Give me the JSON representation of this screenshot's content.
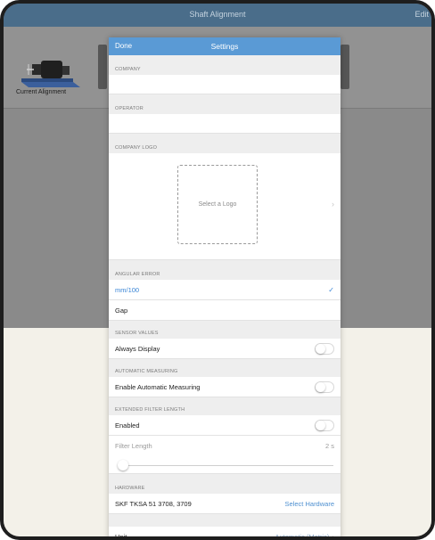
{
  "background": {
    "title": "Shaft Alignment",
    "edit_label": "Edit",
    "thumb_label": "Current Alignment"
  },
  "modal": {
    "done_label": "Done",
    "title": "Settings",
    "company": {
      "header": "COMPANY",
      "value": ""
    },
    "operator": {
      "header": "OPERATOR",
      "value": ""
    },
    "company_logo": {
      "header": "COMPANY LOGO",
      "placeholder": "Select a Logo"
    },
    "angular_error": {
      "header": "ANGULAR ERROR",
      "options": [
        {
          "label": "mm/100",
          "selected": true
        },
        {
          "label": "Gap",
          "selected": false
        }
      ]
    },
    "sensor_values": {
      "header": "SENSOR VALUES",
      "label": "Always Display",
      "on": false
    },
    "automatic_measuring": {
      "header": "AUTOMATIC MEASURING",
      "label": "Enable Automatic Measuring",
      "on": false
    },
    "extended_filter": {
      "header": "EXTENDED FILTER LENGTH",
      "enabled_label": "Enabled",
      "enabled": false,
      "filter_label": "Filter Length",
      "filter_value": "2 s"
    },
    "hardware": {
      "header": "HARDWARE",
      "value": "SKF TKSA 51 3708, 3709",
      "action": "Select Hardware"
    },
    "unit": {
      "label": "Unit",
      "value": "Automatic (Metric)"
    }
  },
  "colors": {
    "accent": "#5a9ad5",
    "link": "#4d8fd0",
    "nav_bg": "#4a6d8a"
  }
}
